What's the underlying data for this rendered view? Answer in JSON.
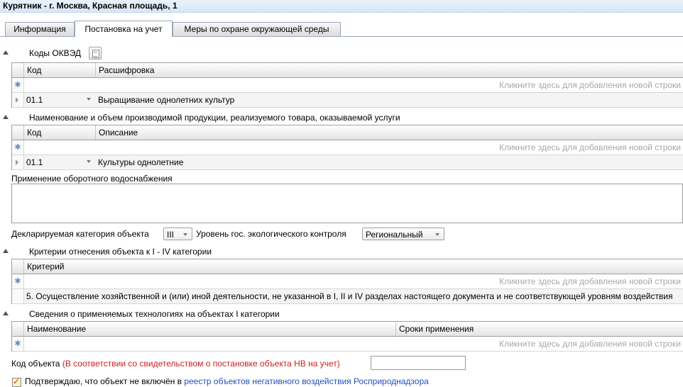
{
  "window_title": "Курятник - г. Москва,  Красная площадь, 1",
  "tabs": [
    {
      "label": "Информация"
    },
    {
      "label": "Постановка на учет"
    },
    {
      "label": "Меры по охране окружающей среды"
    }
  ],
  "okved": {
    "title": "Коды ОКВЭД",
    "columns": [
      "Код",
      "Расшифровка"
    ],
    "new_row_hint": "Кликните здесь для добавления новой строки",
    "rows": [
      {
        "code": "01.1",
        "text": "Выращивание однолетних культур"
      }
    ]
  },
  "products": {
    "title": "Наименование и объем производимой продукции, реализуемого товара, оказываемой услуги",
    "columns": [
      "Код",
      "Описание"
    ],
    "new_row_hint": "Кликните здесь для добавления новой строки",
    "rows": [
      {
        "code": "01.1",
        "text": "Культуры однолетние"
      }
    ]
  },
  "water": {
    "label": "Применение оборотного водоснабжения",
    "value": ""
  },
  "category": {
    "label": "Декларируемая категория объекта",
    "value": "III",
    "control_label": "Уровень гос. экологического контроля",
    "control_value": "Региональный"
  },
  "criteria": {
    "title": "Критерии отнесения объекта к I - IV категории",
    "columns": [
      "Критерий"
    ],
    "new_row_hint": "Кликните здесь для добавления новой строки",
    "rows": [
      {
        "text": "5. Осуществление хозяйственной и (или) иной деятельности, не указанной в I, II и IV разделах настоящего документа и не соответствующей уровням воздействия"
      }
    ]
  },
  "tech": {
    "title": "Сведения о применяемых технологиях на объектах I категории",
    "columns": [
      "Наименование",
      "Сроки применения"
    ],
    "new_row_hint": "Кликните здесь для добавления новой строки"
  },
  "object_code": {
    "label": "Код объекта",
    "note": "(В соответствии со свидетельством о постановке объекта НВ на учет)",
    "value": ""
  },
  "confirm": {
    "text": "Подтверждаю, что объект не включён в",
    "link": "реестр объектов негативного воздействия Росприроднадзора",
    "checked": true
  }
}
